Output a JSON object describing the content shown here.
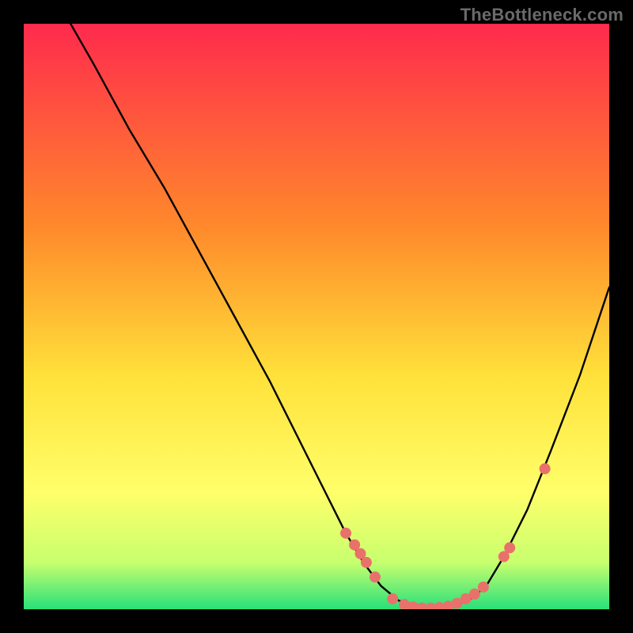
{
  "watermark": "TheBottleneck.com",
  "colors": {
    "gradient_top": "#ff2a4d",
    "gradient_mid1": "#ff8a2b",
    "gradient_mid2": "#ffe13a",
    "gradient_mid3": "#ffff6a",
    "gradient_mid4": "#c8ff6e",
    "gradient_bottom": "#28e07a",
    "curve": "#000000",
    "marker": "#e9716b"
  },
  "chart_data": {
    "type": "line",
    "title": "",
    "xlabel": "",
    "ylabel": "",
    "xlim": [
      0,
      100
    ],
    "ylim": [
      0,
      100
    ],
    "grid": false,
    "legend": false,
    "series": [
      {
        "name": "curve",
        "x": [
          8,
          12,
          18,
          24,
          30,
          36,
          42,
          47,
          51,
          55,
          58,
          61,
          64,
          67,
          70,
          73,
          76,
          79,
          82,
          86,
          90,
          95,
          100
        ],
        "y": [
          100,
          93,
          82,
          72,
          61,
          50,
          39,
          29,
          21,
          13,
          8,
          4,
          1.5,
          0.5,
          0.2,
          0.5,
          1.5,
          4,
          9,
          17,
          27,
          40,
          55
        ]
      }
    ],
    "markers": {
      "name": "highlight-points",
      "x": [
        55,
        56.5,
        57.5,
        58.5,
        60,
        63,
        65,
        66.5,
        68,
        69.5,
        71,
        72.5,
        74,
        75.5,
        77,
        78.5,
        82,
        83,
        89
      ],
      "y": [
        13,
        11,
        9.5,
        8,
        5.5,
        1.8,
        0.8,
        0.4,
        0.2,
        0.2,
        0.3,
        0.5,
        1,
        1.8,
        2.6,
        3.8,
        9,
        10.5,
        24
      ]
    }
  }
}
